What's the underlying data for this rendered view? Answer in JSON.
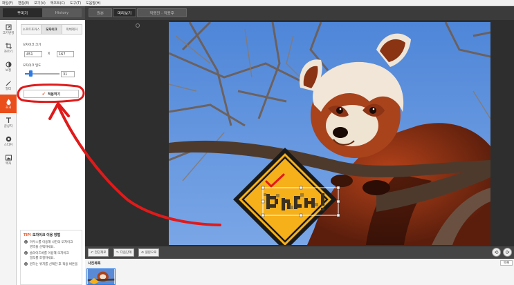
{
  "menu": [
    "파일(F)",
    "편집(E)",
    "보기(V)",
    "액조트(C)",
    "도구(T)",
    "도움말(H)"
  ],
  "left_tabs": {
    "active": "꾸미기",
    "inactive": "History"
  },
  "view_tabs": [
    "원본",
    "미리보기",
    "적용전 · 적용후"
  ],
  "tools": [
    {
      "label": "크기변경",
      "icon": "resize-icon"
    },
    {
      "label": "자르기",
      "icon": "crop-icon"
    },
    {
      "label": "보정",
      "icon": "adjust-icon"
    },
    {
      "label": "필터",
      "icon": "filter-icon"
    },
    {
      "label": "효과",
      "icon": "effect-icon"
    },
    {
      "label": "글상자",
      "icon": "text-icon"
    },
    {
      "label": "스티커",
      "icon": "sticker-icon"
    },
    {
      "label": "액자",
      "icon": "frame-icon"
    }
  ],
  "subtabs": [
    "소프트포커스",
    "모자이크",
    "픽체제거"
  ],
  "mosaic": {
    "size_label": "모자이크 크기",
    "width": "451",
    "height": "167",
    "x_sep": "X",
    "strength_label": "모자이크 밀도",
    "strength": "31",
    "strength_fraction": 0.15
  },
  "apply_button": "적용하기",
  "tip": {
    "tip_word": "TIP!",
    "title": "모자이크 이용 방법",
    "steps": [
      {
        "num": "1",
        "text": "마우스를 이용해 사진의 모자이크"
      },
      {
        "num": "",
        "text": "영역을 선택하세요."
      },
      {
        "num": "2",
        "text": "슬라이드바를 이용해 모자이크"
      },
      {
        "num": "",
        "text": "밀도를 조절하세요."
      },
      {
        "num": "3",
        "text": "원하는 위치를 선택한 후 적용 버튼을"
      }
    ]
  },
  "bottom": {
    "undo": "전단계로",
    "redo": "다음단계",
    "reset": "원본으로"
  },
  "photo_list": {
    "title": "사진목록",
    "button": "목록"
  },
  "colors": {
    "accent": "#e94e1b",
    "selection": "#2a7be4",
    "annotation": "#e01a1a"
  }
}
